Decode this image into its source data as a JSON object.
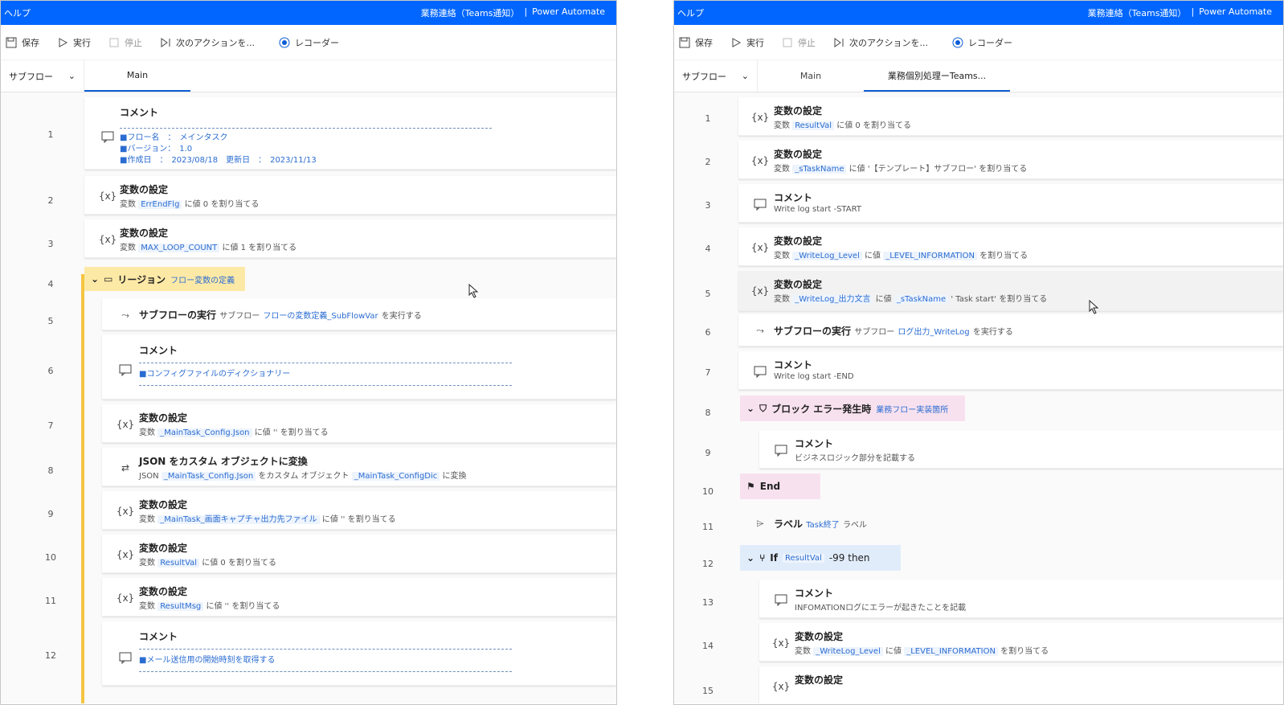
{
  "left": {
    "titlebar": {
      "help": "ヘルプ",
      "flow_name": "業務連絡（Teams通知）",
      "separator": "|",
      "app": "Power Automate"
    },
    "toolbar": {
      "save": "保存",
      "run": "実行",
      "stop": "停止",
      "next": "次のアクションを...",
      "recorder": "レコーダー"
    },
    "tabs": {
      "subflow": "サブフロー",
      "main": "Main"
    },
    "rows": [
      {
        "n": "1",
        "title": "コメント",
        "c1": "■フロー名　：　メインタスク",
        "c2": "■バージョン：　1.0",
        "c3": "■作成日　：　2023/08/18　更新日　：　2023/11/13"
      },
      {
        "n": "2",
        "title": "変数の設定",
        "p": "変数",
        "v": "ErrEndFlg",
        "s": "に値 0 を割り当てる"
      },
      {
        "n": "3",
        "title": "変数の設定",
        "p": "変数",
        "v": "MAX_LOOP_COUNT",
        "s": "に値 1 を割り当てる"
      },
      {
        "n": "4",
        "title": "リージョン",
        "v": "フロー変数の定義"
      },
      {
        "n": "5",
        "title": "サブフローの実行",
        "p": "サブフロー",
        "v": "フローの変数定義_SubFlowVar",
        "s": "を実行する"
      },
      {
        "n": "6",
        "title": "コメント",
        "c1": "■コンフィグファイルのディクショナリー"
      },
      {
        "n": "7",
        "title": "変数の設定",
        "p": "変数",
        "v": "_MainTask_Config.Json",
        "s": "に値 '' を割り当てる"
      },
      {
        "n": "8",
        "title": "JSON をカスタム オブジェクトに変換",
        "p": "JSON",
        "v": "_MainTask_Config.Json",
        "s": "をカスタム オブジェクト",
        "v2": "_MainTask_ConfigDic",
        "s2": "に変換"
      },
      {
        "n": "9",
        "title": "変数の設定",
        "p": "変数",
        "v": "_MainTask_画面キャプチャ出力先ファイル",
        "s": "に値 '' を割り当てる"
      },
      {
        "n": "10",
        "title": "変数の設定",
        "p": "変数",
        "v": "ResultVal",
        "s": "に値 0 を割り当てる"
      },
      {
        "n": "11",
        "title": "変数の設定",
        "p": "変数",
        "v": "ResultMsg",
        "s": "に値 '' を割り当てる"
      },
      {
        "n": "12",
        "title": "コメント",
        "c1": "■メール送信用の開始時刻を取得する"
      }
    ]
  },
  "right": {
    "titlebar": {
      "help": "ヘルプ",
      "flow_name": "業務連絡（Teams通知）",
      "separator": "|",
      "app": "Power Automate"
    },
    "toolbar": {
      "save": "保存",
      "run": "実行",
      "stop": "停止",
      "next": "次のアクションを...",
      "recorder": "レコーダー"
    },
    "tabs": {
      "subflow": "サブフロー",
      "main": "Main",
      "second": "業務個別処理ーTeams..."
    },
    "rows": [
      {
        "n": "1",
        "title": "変数の設定",
        "p": "変数",
        "v": "ResultVal",
        "s": "に値 0 を割り当てる"
      },
      {
        "n": "2",
        "title": "変数の設定",
        "p": "変数",
        "v": "_sTaskName",
        "s": "に値 '【テンプレート】サブフロー' を割り当てる"
      },
      {
        "n": "3",
        "title": "コメント",
        "c1": "Write log start -START"
      },
      {
        "n": "4",
        "title": "変数の設定",
        "p": "変数",
        "v": "_WriteLog_Level",
        "s": "に値",
        "v2": "_LEVEL_INFORMATION",
        "s2": "を割り当てる"
      },
      {
        "n": "5",
        "title": "変数の設定",
        "p": "変数",
        "v": "_WriteLog_出力文言",
        "s": "に値",
        "v2": "_sTaskName",
        "s2": "' Task start' を割り当てる"
      },
      {
        "n": "6",
        "title": "サブフローの実行",
        "p": "サブフロー",
        "v": "ログ出力_WriteLog",
        "s": "を実行する"
      },
      {
        "n": "7",
        "title": "コメント",
        "c1": "Write log start -END"
      },
      {
        "n": "8",
        "title": "ブロック エラー発生時",
        "v": "業務フロー実装箇所"
      },
      {
        "n": "9",
        "title": "コメント",
        "c1": "ビジネスロジック部分を記載する"
      },
      {
        "n": "10",
        "title": "End"
      },
      {
        "n": "11",
        "title": "ラベル",
        "v": "Task終了",
        "s": "ラベル"
      },
      {
        "n": "12",
        "title": "If",
        "v": "ResultVal",
        "s": "-99 then"
      },
      {
        "n": "13",
        "title": "コメント",
        "c1": "INFOMATIONログにエラーが起きたことを記載"
      },
      {
        "n": "14",
        "title": "変数の設定",
        "p": "変数",
        "v": "_WriteLog_Level",
        "s": "に値",
        "v2": "_LEVEL_INFORMATION",
        "s2": "を割り当てる"
      },
      {
        "n": "15",
        "title": "変数の設定"
      }
    ]
  }
}
